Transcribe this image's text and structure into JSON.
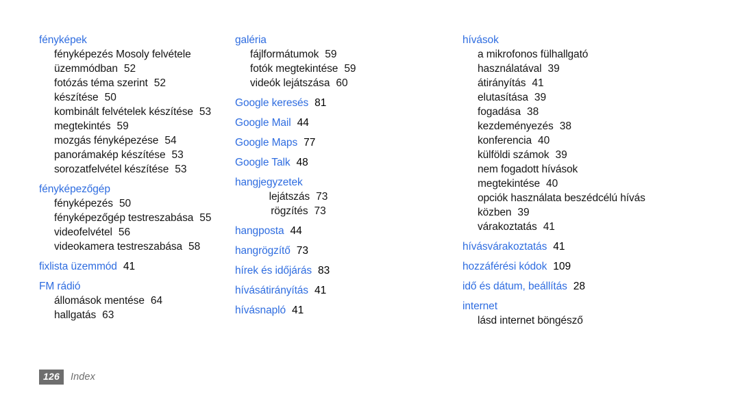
{
  "document": {
    "footer": {
      "page_number": "126",
      "section_label": "Index"
    },
    "colors": {
      "heading_blue": "#2f6de0",
      "body_black": "#151515",
      "footer_gray": "#6e6e6e"
    }
  },
  "columns": [
    {
      "id": "column-1",
      "groups": [
        {
          "main": {
            "label": "fényképek",
            "page": ""
          },
          "subs": [
            {
              "label": "fényképezés Mosoly felvétele",
              "page": ""
            },
            {
              "label": "üzemmódban",
              "page": "52"
            },
            {
              "label": "fotózás téma szerint",
              "page": "52"
            },
            {
              "label": "készítése",
              "page": "50"
            },
            {
              "label": "kombinált felvételek készítése",
              "page": "53"
            },
            {
              "label": "megtekintés",
              "page": "59"
            },
            {
              "label": "mozgás fényképezése",
              "page": "54"
            },
            {
              "label": "panorámakép készítése",
              "page": "53"
            },
            {
              "label": "sorozatfelvétel készítése",
              "page": "53"
            }
          ]
        },
        {
          "main": {
            "label": "fényképezőgép",
            "page": ""
          },
          "subs": [
            {
              "label": "fényképezés",
              "page": "50"
            },
            {
              "label": "fényképezőgép testreszabása",
              "page": "55"
            },
            {
              "label": "videofelvétel",
              "page": "56"
            },
            {
              "label": "videokamera testreszabása",
              "page": "58"
            }
          ]
        },
        {
          "main": {
            "label": "fixlista üzemmód",
            "page": "41"
          },
          "subs": []
        },
        {
          "main": {
            "label": "FM rádió",
            "page": ""
          },
          "subs": [
            {
              "label": "állomások mentése",
              "page": "64"
            },
            {
              "label": "hallgatás",
              "page": "63"
            }
          ]
        }
      ]
    },
    {
      "id": "column-2",
      "groups": [
        {
          "main": {
            "label": "galéria",
            "page": ""
          },
          "subs": [
            {
              "label": "fájlformátumok",
              "page": "59"
            },
            {
              "label": "fotók megtekintése",
              "page": "59"
            },
            {
              "label": "videók lejátszása",
              "page": "60"
            }
          ]
        },
        {
          "main": {
            "label": "Google keresés",
            "page": "81"
          },
          "subs": []
        },
        {
          "main": {
            "label": "Google Mail",
            "page": "44"
          },
          "subs": []
        },
        {
          "main": {
            "label": "Google Maps",
            "page": "77"
          },
          "subs": []
        },
        {
          "main": {
            "label": "Google Talk",
            "page": "48"
          },
          "subs": []
        },
        {
          "main": {
            "label": "hangjegyzetek",
            "page": ""
          },
          "centered_subs": true,
          "subs": [
            {
              "label": "lejátszás",
              "page": "73"
            },
            {
              "label": "rögzítés",
              "page": "73"
            }
          ]
        },
        {
          "main": {
            "label": "hangposta",
            "page": "44"
          },
          "subs": []
        },
        {
          "main": {
            "label": "hangrögzítő",
            "page": "73"
          },
          "subs": []
        },
        {
          "main": {
            "label": "hírek és időjárás",
            "page": "83"
          },
          "subs": []
        },
        {
          "main": {
            "label": "hívásátirányítás",
            "page": "41"
          },
          "subs": []
        },
        {
          "main": {
            "label": "hívásnapló",
            "page": "41"
          },
          "subs": []
        }
      ]
    },
    {
      "id": "column-3",
      "groups": [
        {
          "main": {
            "label": "hívások",
            "page": ""
          },
          "subs": [
            {
              "label": "a mikrofonos fülhallgató",
              "page": ""
            },
            {
              "label": "használatával",
              "page": "39"
            },
            {
              "label": "átirányítás",
              "page": "41"
            },
            {
              "label": "elutasítása",
              "page": "39"
            },
            {
              "label": "fogadása",
              "page": "38"
            },
            {
              "label": "kezdeményezés",
              "page": "38"
            },
            {
              "label": "konferencia",
              "page": "40"
            },
            {
              "label": "külföldi számok",
              "page": "39"
            },
            {
              "label": "nem fogadott hívások",
              "page": ""
            },
            {
              "label": "megtekintése",
              "page": "40"
            },
            {
              "label": "opciók használata beszédcélú hívás",
              "page": ""
            },
            {
              "label": "közben",
              "page": "39"
            },
            {
              "label": "várakoztatás",
              "page": "41"
            }
          ]
        },
        {
          "main": {
            "label": "hívásvárakoztatás",
            "page": "41"
          },
          "subs": []
        },
        {
          "main": {
            "label": "hozzáférési kódok",
            "page": "109"
          },
          "subs": []
        },
        {
          "main": {
            "label": "idő és dátum, beállítás",
            "page": "28"
          },
          "subs": []
        },
        {
          "main": {
            "label": "internet",
            "page": ""
          },
          "subs": [
            {
              "label": "lásd internet böngésző",
              "page": ""
            }
          ]
        }
      ]
    }
  ]
}
